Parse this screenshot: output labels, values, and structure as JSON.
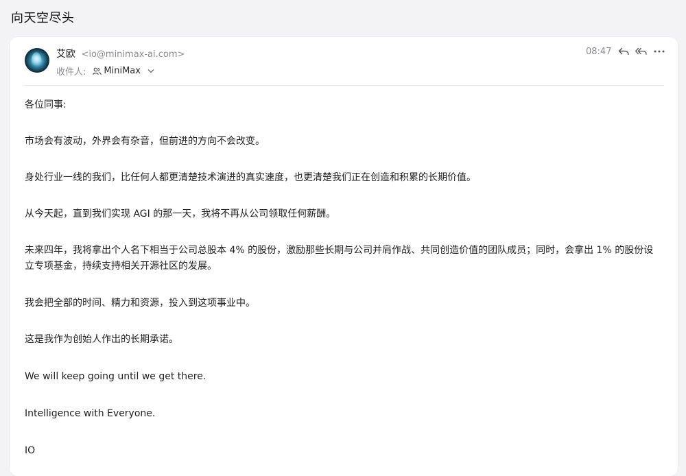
{
  "email": {
    "subject": "向天空尽头",
    "sender_name": "艾欧",
    "sender_email": "<io@minimax-ai.com>",
    "recipient_label": "收件人:",
    "recipient_name": "MiniMax",
    "time": "08:47",
    "icons": {
      "avatar": "sender-avatar",
      "recipient": "person-group-icon",
      "expand": "chevron-down-icon",
      "reply": "reply-icon",
      "reply_all": "reply-all-icon",
      "more": "more-icon"
    },
    "body": [
      "各位同事:",
      "市场会有波动，外界会有杂音，但前进的方向不会改变。",
      "身处行业一线的我们，比任何人都更清楚技术演进的真实速度，也更清楚我们正在创造和积累的长期价值。",
      "从今天起，直到我们实现 AGI 的那一天，我将不再从公司领取任何薪酬。",
      "未来四年，我将拿出个人名下相当于公司总股本 4% 的股份，激励那些长期与公司并肩作战、共同创造价值的团队成员；同时，会拿出 1% 的股份设立专项基金，持续支持相关开源社区的发展。",
      "我会把全部的时间、精力和资源，投入到这项事业中。",
      "这是我作为创始人作出的长期承诺。",
      "We will keep going until we get there.",
      "Intelligence with Everyone.",
      "IO"
    ]
  }
}
